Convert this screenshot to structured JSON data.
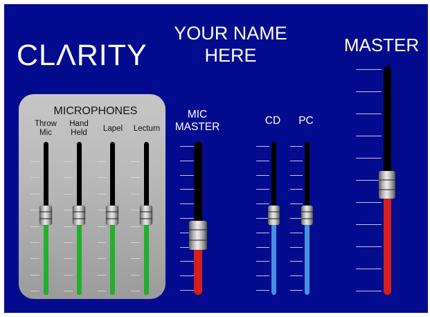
{
  "logo": {
    "text": "CLΛRITY"
  },
  "heading": {
    "line1": "YOUR  NAME",
    "line2": "HERE"
  },
  "microphones": {
    "title": "MICROPHONES",
    "channels": [
      {
        "label": "Throw\nMic",
        "level": 0.52
      },
      {
        "label": "Hand\nHeld",
        "level": 0.52
      },
      {
        "label": "Lapel",
        "level": 0.52
      },
      {
        "label": "Lecturn",
        "level": 0.52
      }
    ]
  },
  "mic_master": {
    "label": "MIC\nMASTER",
    "level": 0.39
  },
  "cd": {
    "label": "CD",
    "level": 0.52
  },
  "pc": {
    "label": "PC",
    "level": 0.52
  },
  "master": {
    "label": "MASTER",
    "level": 0.48
  },
  "colors": {
    "panel": "#030c8e",
    "mic_fill": "#22b02c",
    "master_fill": "#d81e1e",
    "source_fill": "#4a8fe0"
  }
}
